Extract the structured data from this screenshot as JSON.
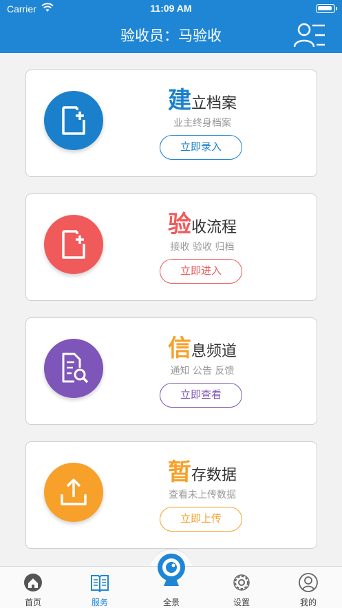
{
  "status_bar": {
    "carrier": "Carrier",
    "time": "11:09 AM"
  },
  "header": {
    "title": "验收员：马验收"
  },
  "cards": [
    {
      "big_char": "建",
      "title_rest": "立档案",
      "subtitle": "业主终身档案",
      "button": "立即录入",
      "color": "#1a80cc",
      "icon": "file-add-icon"
    },
    {
      "big_char": "验",
      "title_rest": "收流程",
      "subtitle": "接收 验收 归档",
      "button": "立即进入",
      "color": "#f05a5a",
      "icon": "file-add-icon"
    },
    {
      "big_char": "信",
      "title_rest": "息频道",
      "subtitle": "通知 公告 反馈",
      "button": "立即查看",
      "color": "#7e55b8",
      "icon": "document-search-icon"
    },
    {
      "big_char": "暂",
      "title_rest": "存数据",
      "subtitle": "查看未上传数据",
      "button": "立即上传",
      "color": "#f7a02a",
      "icon": "upload-icon"
    }
  ],
  "tabs": [
    {
      "label": "首页",
      "icon": "home-icon",
      "active": false
    },
    {
      "label": "服务",
      "icon": "book-icon",
      "active": true
    },
    {
      "label": "全景",
      "icon": "camera-icon",
      "active": false
    },
    {
      "label": "设置",
      "icon": "gear-icon",
      "active": false
    },
    {
      "label": "我的",
      "icon": "user-icon",
      "active": false
    }
  ],
  "colors": {
    "header": "#1f86d6",
    "tab_active": "#1f86d6",
    "tab_inactive": "#444444"
  }
}
